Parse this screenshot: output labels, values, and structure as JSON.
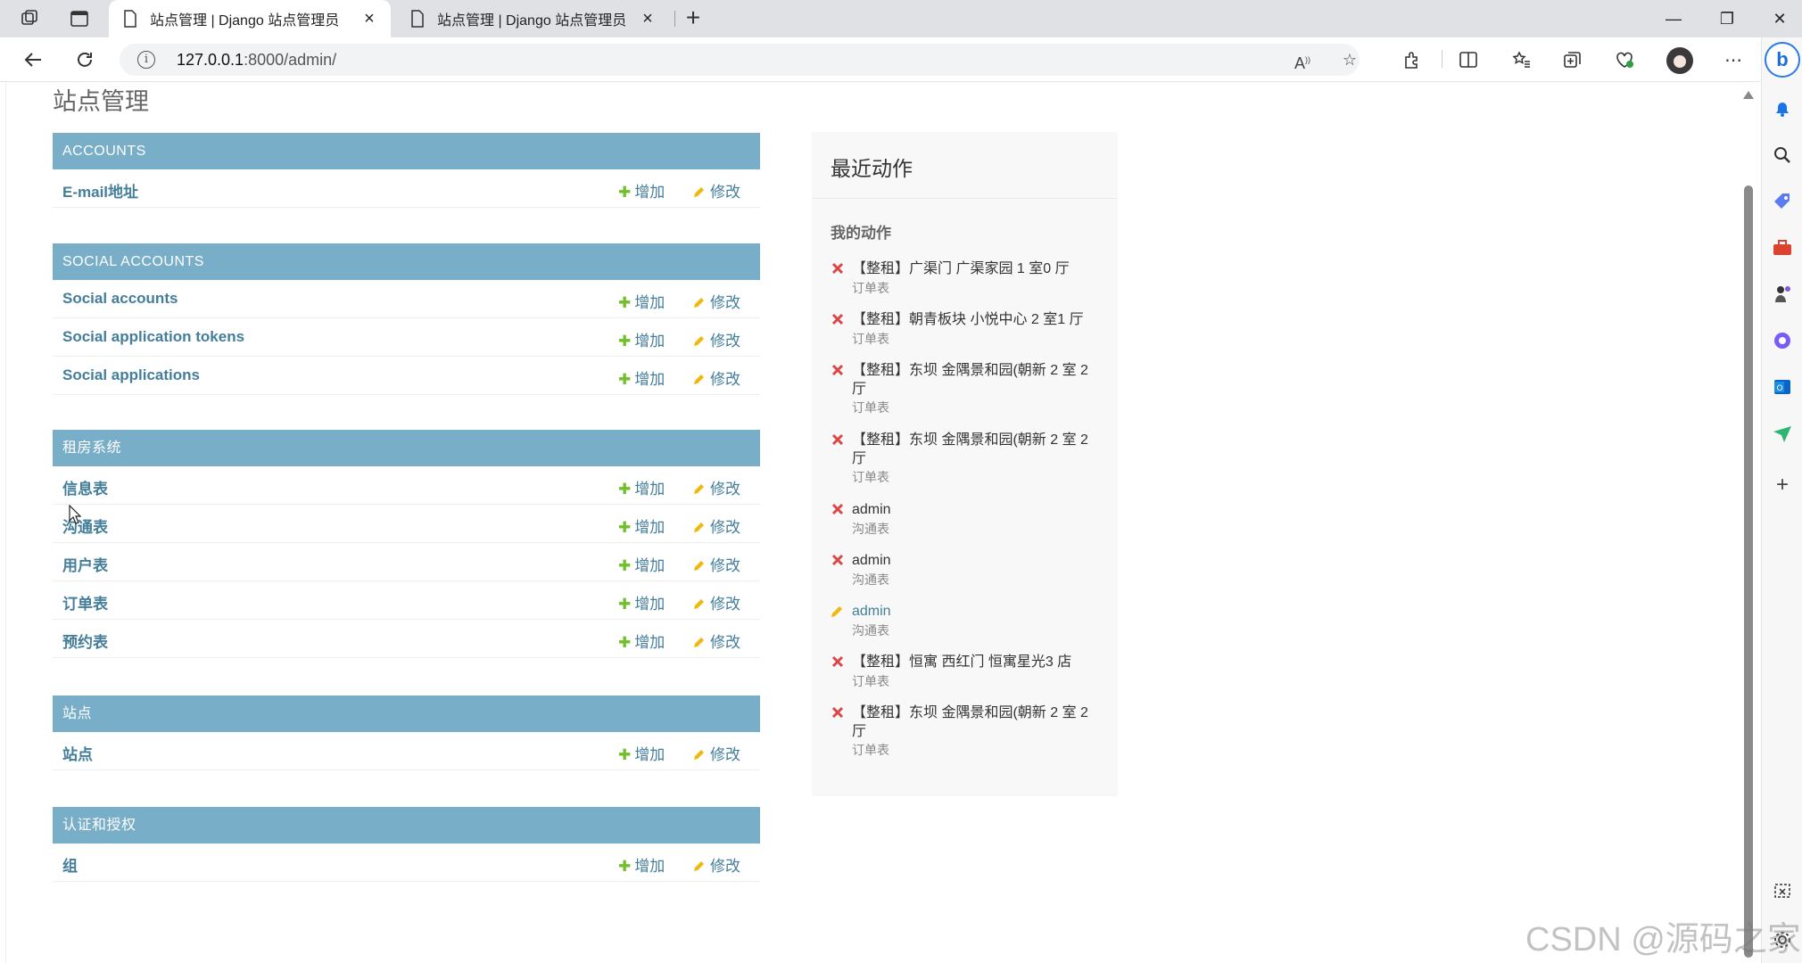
{
  "browser": {
    "tabs": [
      {
        "title": "站点管理 | Django 站点管理员",
        "active": true
      },
      {
        "title": "站点管理 | Django 站点管理员",
        "active": false
      }
    ],
    "address": {
      "host": "127.0.0.1",
      "rest": ":8000/admin/"
    }
  },
  "page": {
    "title": "站点管理",
    "add_label": "增加",
    "change_label": "修改"
  },
  "modules": [
    {
      "caption": "ACCOUNTS",
      "rows": [
        "E-mail地址"
      ]
    },
    {
      "caption": "SOCIAL ACCOUNTS",
      "rows": [
        "Social accounts",
        "Social application tokens",
        "Social applications"
      ]
    },
    {
      "caption": "租房系统",
      "rows": [
        "信息表",
        "沟通表",
        "用户表",
        "订单表",
        "预约表"
      ]
    },
    {
      "caption": "站点",
      "rows": [
        "站点"
      ]
    },
    {
      "caption": "认证和授权",
      "rows": [
        "组"
      ]
    }
  ],
  "recent": {
    "title": "最近动作",
    "subtitle": "我的动作",
    "actions": [
      {
        "icon": "delete",
        "label": "【整租】广渠门 广渠家园 1 室0 厅",
        "content_type": "订单表"
      },
      {
        "icon": "delete",
        "label": "【整租】朝青板块 小悦中心 2 室1 厅",
        "content_type": "订单表"
      },
      {
        "icon": "delete",
        "label": "【整租】东坝 金隅景和园(朝新 2 室 2 厅",
        "content_type": "订单表"
      },
      {
        "icon": "delete",
        "label": "【整租】东坝 金隅景和园(朝新 2 室 2 厅",
        "content_type": "订单表"
      },
      {
        "icon": "delete",
        "label": "admin",
        "content_type": "沟通表"
      },
      {
        "icon": "delete",
        "label": "admin",
        "content_type": "沟通表"
      },
      {
        "icon": "change",
        "label": "admin",
        "content_type": "沟通表"
      },
      {
        "icon": "delete",
        "label": "【整租】恒寓 西红门 恒寓星光3 店",
        "content_type": "订单表"
      },
      {
        "icon": "delete",
        "label": "【整租】东坝 金隅景和园(朝新 2 室 2 厅",
        "content_type": "订单表"
      }
    ]
  },
  "watermark": "CSDN @源码之家",
  "colors": {
    "module_caption_bg": "#79aec8",
    "link": "#447e9b",
    "add_plus": "#70bf2b",
    "change_pencil": "#efb80b",
    "delete_x": "#dd4646"
  }
}
